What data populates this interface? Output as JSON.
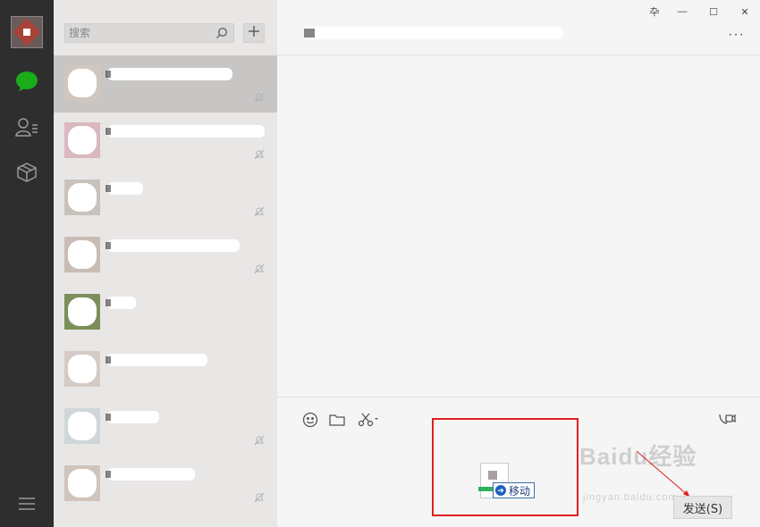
{
  "search": {
    "placeholder": "搜索"
  },
  "colors": {
    "accent": "#1aad19",
    "highlight_box": "#e02020",
    "rail_bg": "#2e2e2e"
  },
  "rail": {
    "icons": [
      "chat-icon",
      "contacts-icon",
      "favorites-icon",
      "menu-icon"
    ]
  },
  "chat_list": {
    "items": [
      {
        "name": "",
        "muted": true,
        "active": true
      },
      {
        "name": "",
        "muted": true,
        "active": false
      },
      {
        "name": "",
        "muted": true,
        "active": false
      },
      {
        "name": "",
        "muted": true,
        "active": false
      },
      {
        "name": "",
        "muted": false,
        "active": false
      },
      {
        "name": "",
        "muted": false,
        "active": false
      },
      {
        "name": "",
        "muted": true,
        "active": false
      },
      {
        "name": "",
        "muted": true,
        "active": false
      }
    ]
  },
  "window": {
    "pin_label": "卆",
    "minimize_label": "—",
    "maximize_label": "☐",
    "close_label": "✕",
    "more_label": "···"
  },
  "composer": {
    "drag_tooltip": "移动",
    "send_label": "发送(S)"
  },
  "watermark": {
    "brand": "Baidu经验",
    "url": "jingyan.baidu.com"
  }
}
